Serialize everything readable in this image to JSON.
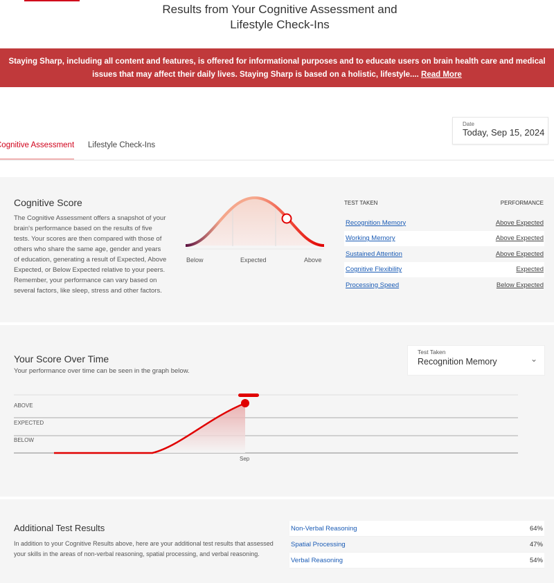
{
  "header": {
    "title_line1": "Results from Your Cognitive Assessment and",
    "title_line2": "Lifestyle Check-Ins"
  },
  "banner": {
    "text": "Staying Sharp, including all content and features, is offered for informational purposes and to educate users on brain health care and medical issues that may affect their daily lives. Staying Sharp is based on a holistic, lifestyle....",
    "link": "Read More",
    "color": "#c0393b"
  },
  "date": {
    "label": "Date",
    "value": "Today,  Sep 15, 2024"
  },
  "tabs": [
    {
      "label": "Cognitive Assessment",
      "active": true
    },
    {
      "label": "Lifestyle Check-Ins",
      "active": false
    }
  ],
  "cognitive": {
    "title": "Cognitive Score",
    "description": "The Cognitive Assessment offers a snapshot of your brain's performance based on the results of five tests. Your scores are then compared with those of others who share the same age, gender and years of education, generating a result of Expected, Above Expected, or Below Expected relative to your peers. Remember, your performance can vary based on several factors, like sleep, stress and other factors.",
    "curve_labels": [
      "Below",
      "Expected",
      "Above"
    ],
    "table_headers": [
      "TEST TAKEN",
      "PERFORMANCE"
    ],
    "rows": [
      {
        "test": "Recognition Memory",
        "result": "Above Expected"
      },
      {
        "test": "Working Memory",
        "result": "Above Expected"
      },
      {
        "test": "Sustained Attention",
        "result": "Above Expected"
      },
      {
        "test": "Cognitive Flexibility",
        "result": "Expected"
      },
      {
        "test": "Processing Speed",
        "result": "Below Expected"
      }
    ]
  },
  "over_time": {
    "title": "Your Score Over Time",
    "subtitle": "Your performance over time can be seen in the graph below.",
    "select_label": "Test Taken",
    "select_value": "Recognition Memory"
  },
  "chart_data": {
    "type": "line",
    "y_levels": [
      "BELOW",
      "EXPECTED",
      "ABOVE"
    ],
    "x_ticks": [
      "Sep"
    ],
    "points": [
      {
        "x": "Sep",
        "y": "ABOVE"
      }
    ],
    "color": "#e00000"
  },
  "additional": {
    "title": "Additional Test Results",
    "description": "In addition to your Cognitive Results above, here are your additional test results that assessed your skills in the areas of non-verbal reasoning, spatial processing, and verbal reasoning.",
    "rows": [
      {
        "name": "Non-Verbal Reasoning",
        "value": "64%"
      },
      {
        "name": "Spatial Processing",
        "value": "47%"
      },
      {
        "name": "Verbal Reasoning",
        "value": "54%"
      }
    ]
  }
}
